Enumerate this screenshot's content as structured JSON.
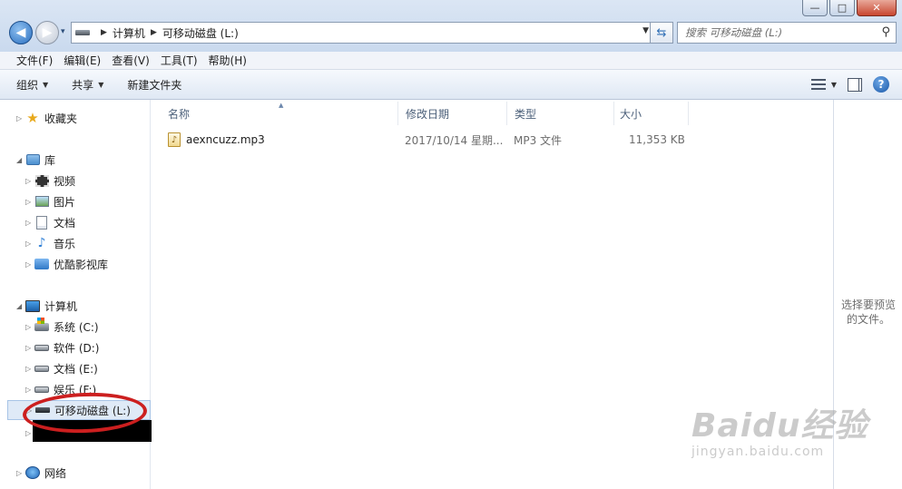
{
  "window": {
    "controls": {
      "minimize": "—",
      "maximize": "□",
      "close": "✕"
    }
  },
  "navigation": {
    "back": "◀",
    "forward": "▶",
    "recent": "▾",
    "breadcrumb": [
      "计算机",
      "可移动磁盘 (L:)"
    ],
    "search_placeholder": "搜索 可移动磁盘 (L:)"
  },
  "menubar": [
    "文件(F)",
    "编辑(E)",
    "查看(V)",
    "工具(T)",
    "帮助(H)"
  ],
  "toolbar": {
    "organize": "组织",
    "share": "共享",
    "new_folder": "新建文件夹"
  },
  "sidebar": {
    "favorites": "收藏夹",
    "libraries": "库",
    "library_items": [
      "视频",
      "图片",
      "文档",
      "音乐",
      "优酷影视库"
    ],
    "computer": "计算机",
    "drives": [
      "系统 (C:)",
      "软件 (D:)",
      "文档 (E:)",
      "娱乐 (F:)",
      "可移动磁盘 (L:)"
    ],
    "network": "网络"
  },
  "columns": {
    "name": "名称",
    "date": "修改日期",
    "type": "类型",
    "size": "大小"
  },
  "files": [
    {
      "name": "aexncuzz.mp3",
      "date": "2017/10/14 星期...",
      "type": "MP3 文件",
      "size": "11,353 KB"
    }
  ],
  "preview": {
    "text": "选择要预览的文件。"
  },
  "watermark": {
    "logo": "Baidu经验",
    "url": "jingyan.baidu.com"
  },
  "icons": {
    "favorites": "star-icon",
    "libraries": "library-icon",
    "video": "video-library-icon",
    "pictures": "pictures-library-icon",
    "documents": "documents-library-icon",
    "music": "music-note-icon",
    "youku": "folder-icon",
    "computer": "computer-icon",
    "system_drive": "windows-drive-icon",
    "drive": "hard-drive-icon",
    "removable": "usb-drive-icon",
    "network": "network-icon",
    "file": "mp3-file-icon"
  },
  "colors": {
    "annotation": "#cc1f1f",
    "selection": "#dfeaf7",
    "accent": "#2f6eb5"
  }
}
